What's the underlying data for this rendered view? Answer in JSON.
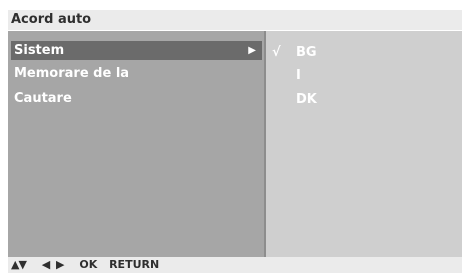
{
  "header": {
    "title": "Acord auto"
  },
  "menu": {
    "items": [
      {
        "label": "Sistem",
        "selected": true,
        "arrow": "▶"
      },
      {
        "label": "Memorare de la",
        "selected": false
      },
      {
        "label": "Cautare",
        "selected": false
      }
    ]
  },
  "options": {
    "items": [
      {
        "label": "BG",
        "checked": true,
        "check_mark": "√"
      },
      {
        "label": "I",
        "checked": false
      },
      {
        "label": "DK",
        "checked": false
      }
    ]
  },
  "footer": {
    "up_down_arrows": "▲▼",
    "left_right_arrows": "◀ ▶",
    "ok_label": "OK",
    "return_label": "RETURN"
  },
  "colors": {
    "title_bar": "#ebebeb",
    "left_panel": "#a6a6a6",
    "right_panel": "#cfcfcf",
    "selected_row": "#6b6b6b",
    "menu_text": "#ffffff",
    "title_text": "#2f2f2f"
  },
  "icons": {
    "submenu_arrow": "submenu-arrow-icon",
    "check_mark": "check-mark-icon",
    "up_down": "up-down-arrows-icon",
    "left_right": "left-right-arrows-icon"
  }
}
